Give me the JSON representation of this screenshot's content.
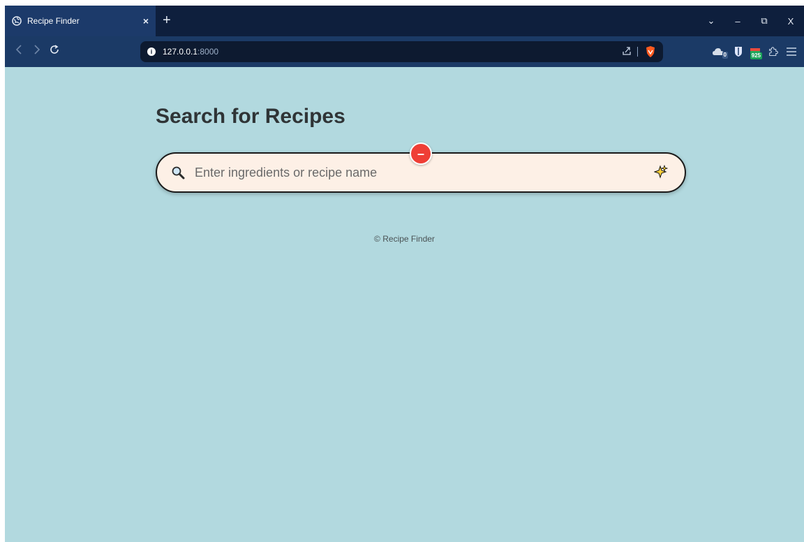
{
  "browser": {
    "tab_title": "Recipe Finder",
    "tab_close": "×",
    "new_tab": "+",
    "url_host": "127.0.0.1",
    "url_port": ":8000",
    "window_controls": {
      "dropdown": "⌄",
      "minimize": "–",
      "restore": "⧉",
      "close": "X"
    },
    "extensions": {
      "cloud_badge": "0",
      "calendar_badge": "925"
    }
  },
  "page": {
    "title": "Search for Recipes",
    "search": {
      "placeholder": "Enter ingredients or recipe name",
      "value": ""
    },
    "remove_button_label": "–",
    "footer": "© Recipe Finder"
  },
  "colors": {
    "page_background": "#b2d9df",
    "search_background": "#fdf0e6",
    "remove_button": "#ef3e36",
    "browser_toolbar": "#1b3a66",
    "tabstrip": "#0e1f3d"
  },
  "icons": [
    "globe-icon",
    "info-icon",
    "share-icon",
    "brave-shield-icon",
    "cloud-icon",
    "bitwarden-icon",
    "calendar-icon",
    "puzzle-icon",
    "menu-icon",
    "search-icon",
    "sparkle-icon"
  ]
}
